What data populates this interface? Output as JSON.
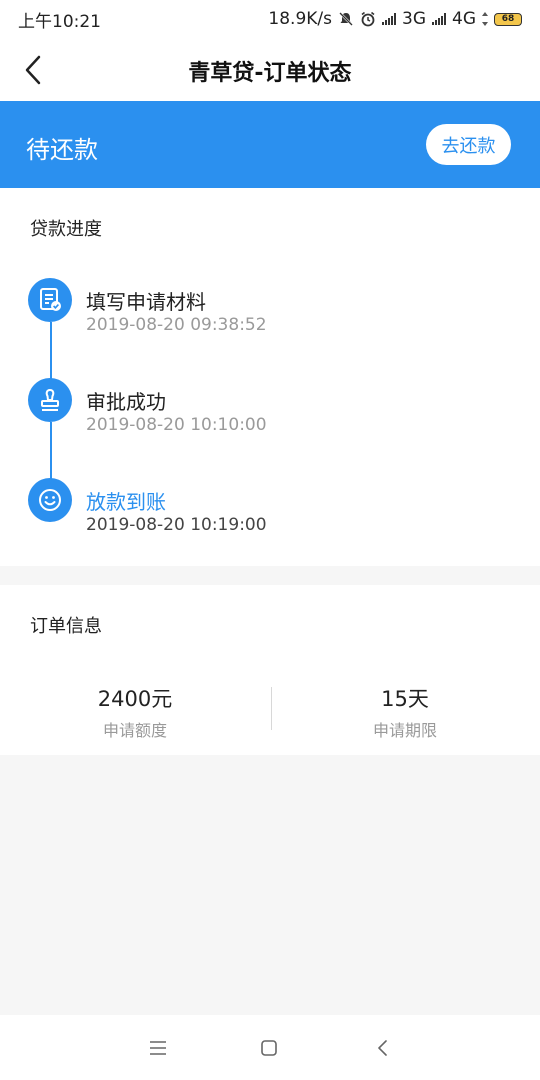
{
  "status_bar": {
    "time": "上午10:21",
    "net_speed": "18.9K/s",
    "sim1": "3G",
    "sim2": "4G",
    "battery": "68"
  },
  "navbar": {
    "title": "青草贷-订单状态"
  },
  "banner": {
    "status": "待还款",
    "repay_button": "去还款",
    "color": "#2b90ef"
  },
  "progress": {
    "title": "贷款进度",
    "steps": [
      {
        "name": "填写申请材料",
        "time": "2019-08-20 09:38:52",
        "icon": "document-check-icon"
      },
      {
        "name": "审批成功",
        "time": "2019-08-20 10:10:00",
        "icon": "stamp-icon"
      },
      {
        "name": "放款到账",
        "time": "2019-08-20 10:19:00",
        "icon": "smiley-icon"
      }
    ]
  },
  "order_info": {
    "title": "订单信息",
    "amount_value": "2400元",
    "amount_label": "申请额度",
    "term_value": "15天",
    "term_label": "申请期限"
  }
}
